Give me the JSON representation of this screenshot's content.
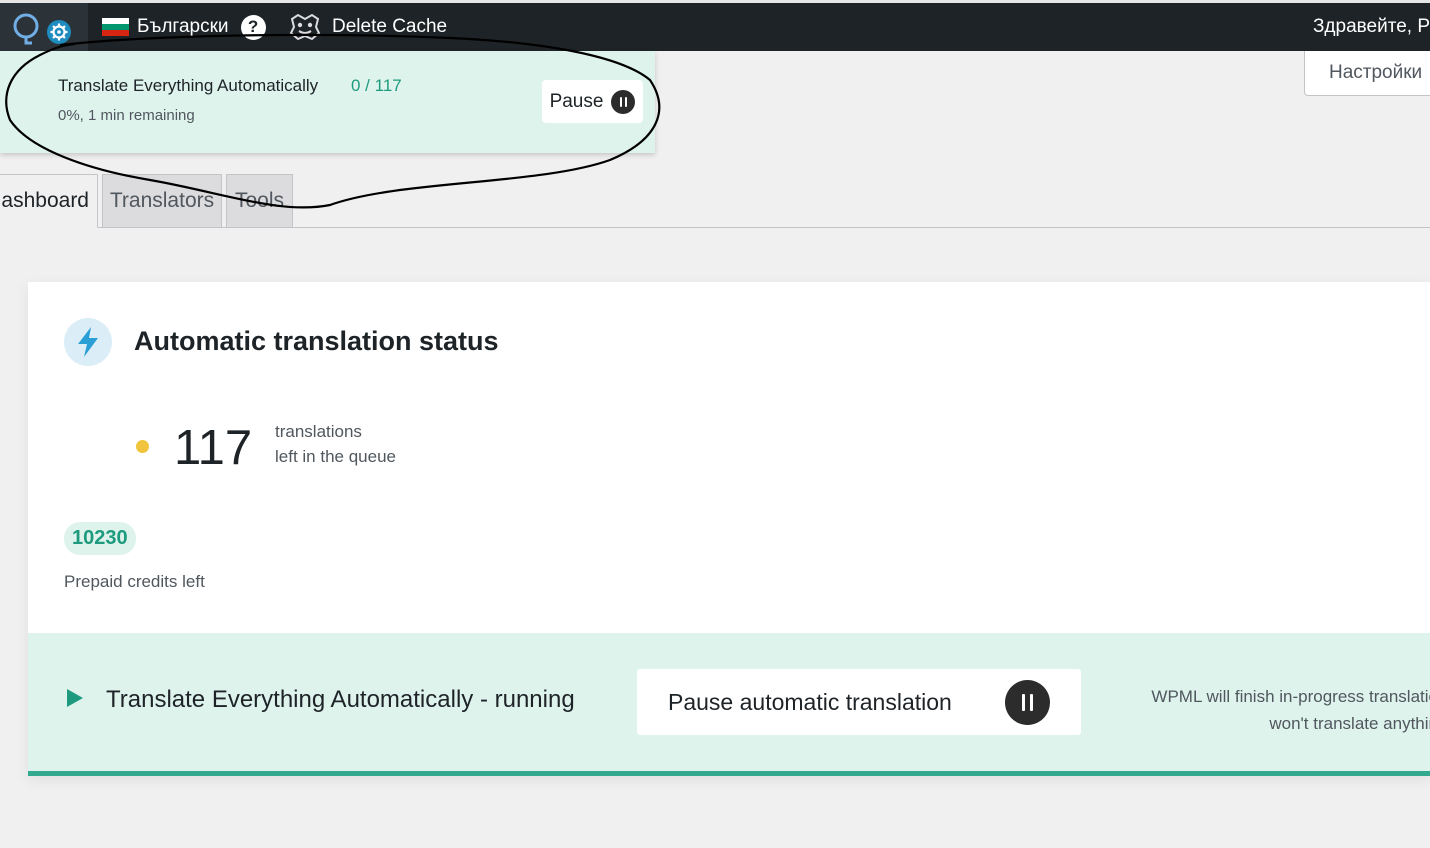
{
  "admin_bar": {
    "language": "Български",
    "help_symbol": "?",
    "delete_cache": "Delete Cache",
    "greeting": "Здравейте, Р",
    "icons": [
      "wordpress-icon",
      "settings-gear-icon",
      "bulgarian-flag-icon",
      "help-icon",
      "cache-logo-icon"
    ]
  },
  "notice": {
    "title": "Translate Everything Automatically",
    "count": "0 / 117",
    "subtitle": "0%, 1 min remaining",
    "pause_label": "Pause"
  },
  "screen_options": "Настройки",
  "tabs": [
    {
      "label": "ashboard",
      "active": true
    },
    {
      "label": "Translators",
      "active": false
    },
    {
      "label": "Tools",
      "active": false
    }
  ],
  "card": {
    "title": "Automatic translation status",
    "queue_count": "117",
    "queue_label_1": "translations",
    "queue_label_2": "left in the queue",
    "credits_value": "10230",
    "credits_label": "Prepaid credits left",
    "footer_title": "Translate Everything Automatically - running",
    "pause_button": "Pause automatic translation",
    "footer_note_1": "WPML will finish in-progress translatio",
    "footer_note_2": "won't translate anythin"
  },
  "colors": {
    "admin_bar": "#1d2327",
    "notice_bg": "#dff3ed",
    "accent_green": "#1e9b7e",
    "queue_dot": "#f0c43c",
    "footer_border": "#33aa90"
  }
}
